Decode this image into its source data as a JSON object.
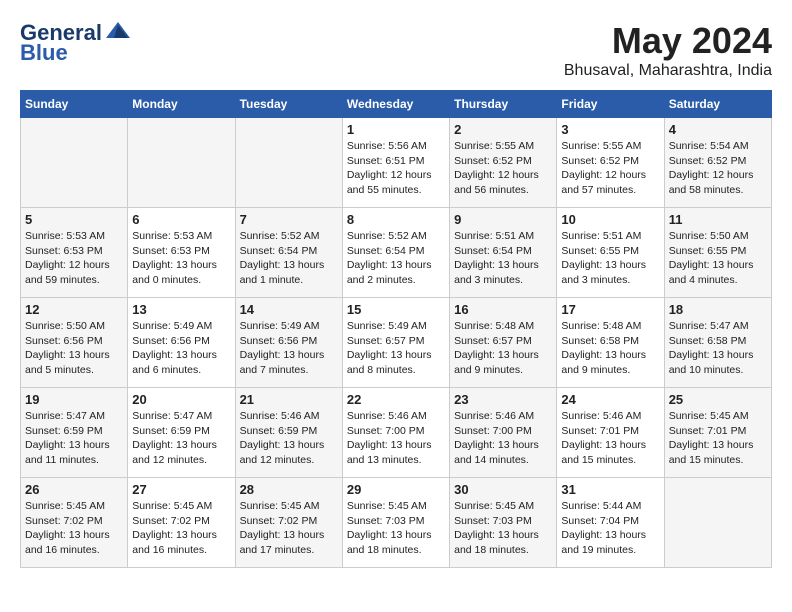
{
  "header": {
    "logo_line1": "General",
    "logo_line2": "Blue",
    "month_year": "May 2024",
    "location": "Bhusaval, Maharashtra, India"
  },
  "weekdays": [
    "Sunday",
    "Monday",
    "Tuesday",
    "Wednesday",
    "Thursday",
    "Friday",
    "Saturday"
  ],
  "weeks": [
    [
      {
        "day": "",
        "info": ""
      },
      {
        "day": "",
        "info": ""
      },
      {
        "day": "",
        "info": ""
      },
      {
        "day": "1",
        "info": "Sunrise: 5:56 AM\nSunset: 6:51 PM\nDaylight: 12 hours\nand 55 minutes."
      },
      {
        "day": "2",
        "info": "Sunrise: 5:55 AM\nSunset: 6:52 PM\nDaylight: 12 hours\nand 56 minutes."
      },
      {
        "day": "3",
        "info": "Sunrise: 5:55 AM\nSunset: 6:52 PM\nDaylight: 12 hours\nand 57 minutes."
      },
      {
        "day": "4",
        "info": "Sunrise: 5:54 AM\nSunset: 6:52 PM\nDaylight: 12 hours\nand 58 minutes."
      }
    ],
    [
      {
        "day": "5",
        "info": "Sunrise: 5:53 AM\nSunset: 6:53 PM\nDaylight: 12 hours\nand 59 minutes."
      },
      {
        "day": "6",
        "info": "Sunrise: 5:53 AM\nSunset: 6:53 PM\nDaylight: 13 hours\nand 0 minutes."
      },
      {
        "day": "7",
        "info": "Sunrise: 5:52 AM\nSunset: 6:54 PM\nDaylight: 13 hours\nand 1 minute."
      },
      {
        "day": "8",
        "info": "Sunrise: 5:52 AM\nSunset: 6:54 PM\nDaylight: 13 hours\nand 2 minutes."
      },
      {
        "day": "9",
        "info": "Sunrise: 5:51 AM\nSunset: 6:54 PM\nDaylight: 13 hours\nand 3 minutes."
      },
      {
        "day": "10",
        "info": "Sunrise: 5:51 AM\nSunset: 6:55 PM\nDaylight: 13 hours\nand 3 minutes."
      },
      {
        "day": "11",
        "info": "Sunrise: 5:50 AM\nSunset: 6:55 PM\nDaylight: 13 hours\nand 4 minutes."
      }
    ],
    [
      {
        "day": "12",
        "info": "Sunrise: 5:50 AM\nSunset: 6:56 PM\nDaylight: 13 hours\nand 5 minutes."
      },
      {
        "day": "13",
        "info": "Sunrise: 5:49 AM\nSunset: 6:56 PM\nDaylight: 13 hours\nand 6 minutes."
      },
      {
        "day": "14",
        "info": "Sunrise: 5:49 AM\nSunset: 6:56 PM\nDaylight: 13 hours\nand 7 minutes."
      },
      {
        "day": "15",
        "info": "Sunrise: 5:49 AM\nSunset: 6:57 PM\nDaylight: 13 hours\nand 8 minutes."
      },
      {
        "day": "16",
        "info": "Sunrise: 5:48 AM\nSunset: 6:57 PM\nDaylight: 13 hours\nand 9 minutes."
      },
      {
        "day": "17",
        "info": "Sunrise: 5:48 AM\nSunset: 6:58 PM\nDaylight: 13 hours\nand 9 minutes."
      },
      {
        "day": "18",
        "info": "Sunrise: 5:47 AM\nSunset: 6:58 PM\nDaylight: 13 hours\nand 10 minutes."
      }
    ],
    [
      {
        "day": "19",
        "info": "Sunrise: 5:47 AM\nSunset: 6:59 PM\nDaylight: 13 hours\nand 11 minutes."
      },
      {
        "day": "20",
        "info": "Sunrise: 5:47 AM\nSunset: 6:59 PM\nDaylight: 13 hours\nand 12 minutes."
      },
      {
        "day": "21",
        "info": "Sunrise: 5:46 AM\nSunset: 6:59 PM\nDaylight: 13 hours\nand 12 minutes."
      },
      {
        "day": "22",
        "info": "Sunrise: 5:46 AM\nSunset: 7:00 PM\nDaylight: 13 hours\nand 13 minutes."
      },
      {
        "day": "23",
        "info": "Sunrise: 5:46 AM\nSunset: 7:00 PM\nDaylight: 13 hours\nand 14 minutes."
      },
      {
        "day": "24",
        "info": "Sunrise: 5:46 AM\nSunset: 7:01 PM\nDaylight: 13 hours\nand 15 minutes."
      },
      {
        "day": "25",
        "info": "Sunrise: 5:45 AM\nSunset: 7:01 PM\nDaylight: 13 hours\nand 15 minutes."
      }
    ],
    [
      {
        "day": "26",
        "info": "Sunrise: 5:45 AM\nSunset: 7:02 PM\nDaylight: 13 hours\nand 16 minutes."
      },
      {
        "day": "27",
        "info": "Sunrise: 5:45 AM\nSunset: 7:02 PM\nDaylight: 13 hours\nand 16 minutes."
      },
      {
        "day": "28",
        "info": "Sunrise: 5:45 AM\nSunset: 7:02 PM\nDaylight: 13 hours\nand 17 minutes."
      },
      {
        "day": "29",
        "info": "Sunrise: 5:45 AM\nSunset: 7:03 PM\nDaylight: 13 hours\nand 18 minutes."
      },
      {
        "day": "30",
        "info": "Sunrise: 5:45 AM\nSunset: 7:03 PM\nDaylight: 13 hours\nand 18 minutes."
      },
      {
        "day": "31",
        "info": "Sunrise: 5:44 AM\nSunset: 7:04 PM\nDaylight: 13 hours\nand 19 minutes."
      },
      {
        "day": "",
        "info": ""
      }
    ]
  ]
}
